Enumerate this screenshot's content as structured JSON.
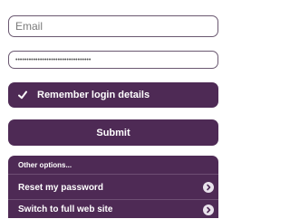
{
  "form": {
    "email_placeholder": "Email",
    "email_value": "",
    "password_value": "••••••••••••••••••••••••••••••••••",
    "remember_label": "Remember login details",
    "submit_label": "Submit"
  },
  "options": {
    "title": "Other options...",
    "items": [
      {
        "label": "Reset my password",
        "icon": "chevron-right-icon"
      },
      {
        "label": "Switch to full web site",
        "icon": "chevron-right-icon"
      }
    ]
  },
  "colors": {
    "accent": "#4e2a55",
    "border": "#6a5870"
  }
}
